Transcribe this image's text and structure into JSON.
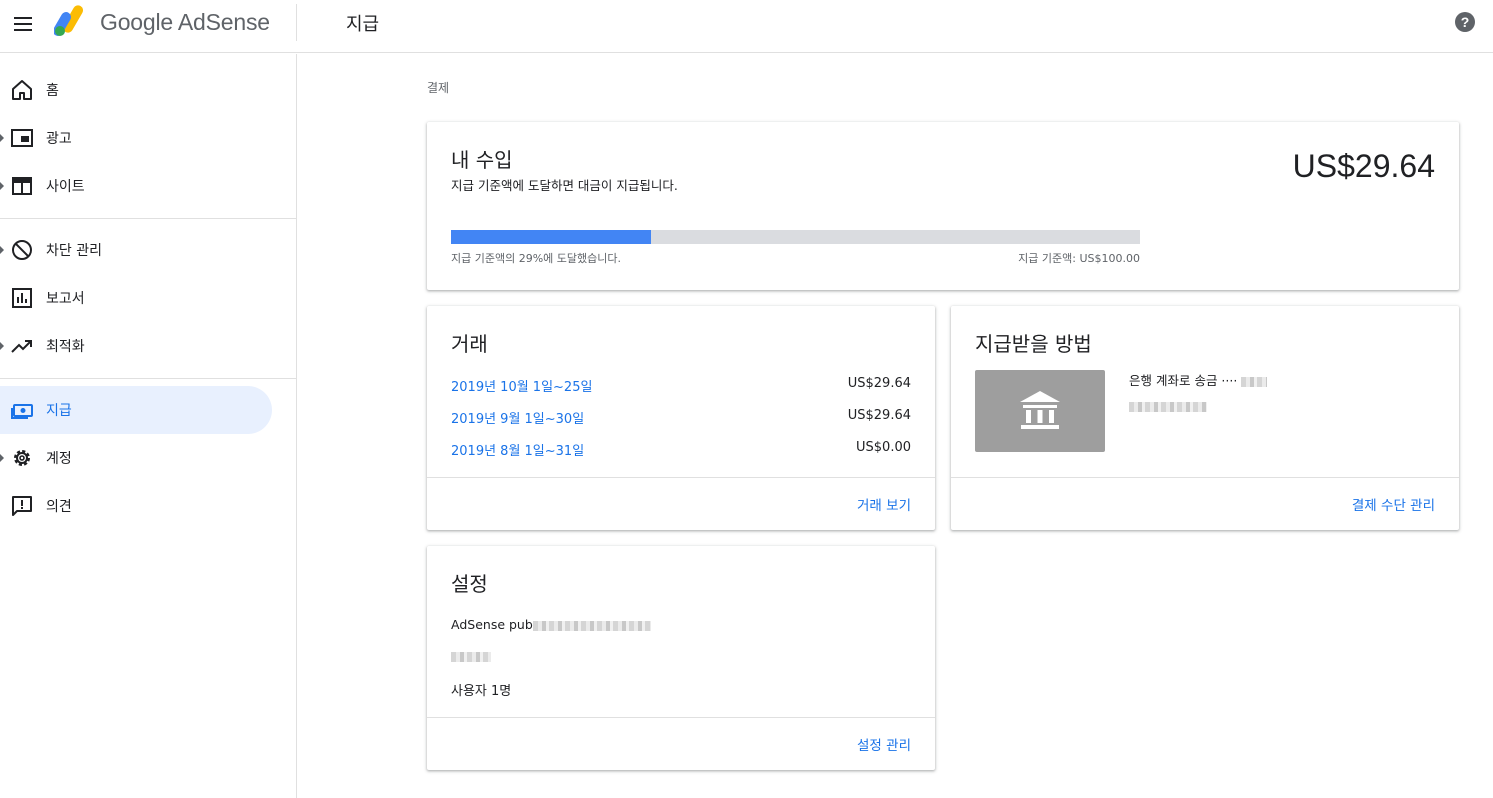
{
  "app": {
    "brand": "Google AdSense",
    "page_title": "지급"
  },
  "icons": {
    "menu": "menu-icon",
    "help": "help-icon",
    "logo": "adsense-logo-icon",
    "bank": "bank-icon"
  },
  "colors": {
    "accent": "#1a73e8",
    "progress": "#4285f4",
    "active_bg": "#e8f0fe"
  },
  "sidebar": {
    "items": [
      {
        "label": "홈",
        "icon": "home-icon",
        "expandable": false
      },
      {
        "label": "광고",
        "icon": "ads-icon",
        "expandable": true
      },
      {
        "label": "사이트",
        "icon": "sites-icon",
        "expandable": true
      },
      {
        "label": "차단 관리",
        "icon": "block-icon",
        "expandable": true
      },
      {
        "label": "보고서",
        "icon": "reports-icon",
        "expandable": false
      },
      {
        "label": "최적화",
        "icon": "trending-icon",
        "expandable": true
      },
      {
        "label": "지급",
        "icon": "payments-icon",
        "expandable": false,
        "active": true
      },
      {
        "label": "계정",
        "icon": "settings-icon",
        "expandable": true
      },
      {
        "label": "의견",
        "icon": "feedback-icon",
        "expandable": false
      }
    ]
  },
  "breadcrumb": "결제",
  "earnings": {
    "title": "내 수입",
    "subtitle": "지급 기준액에 도달하면 대금이 지급됩니다.",
    "amount": "US$29.64",
    "progress_fraction": 0.29,
    "progress_text": "지급 기준액의 29%에 도달했습니다.",
    "threshold_text": "지급 기준액: US$100.00"
  },
  "transactions": {
    "title": "거래",
    "rows": [
      {
        "period": "2019년 10월 1일~25일",
        "amount": "US$29.64"
      },
      {
        "period": "2019년 9월 1일~30일",
        "amount": "US$29.64"
      },
      {
        "period": "2019년 8월 1일~31일",
        "amount": "US$0.00"
      }
    ],
    "footer_link": "거래 보기"
  },
  "payment_method": {
    "title": "지급받을 방법",
    "method_label": "은행 계좌로 송금 ····",
    "footer_link": "결제 수단 관리"
  },
  "settings": {
    "title": "설정",
    "publisher_prefix": "AdSense pub",
    "users_link": "사용자 1명",
    "footer_link": "설정 관리"
  }
}
